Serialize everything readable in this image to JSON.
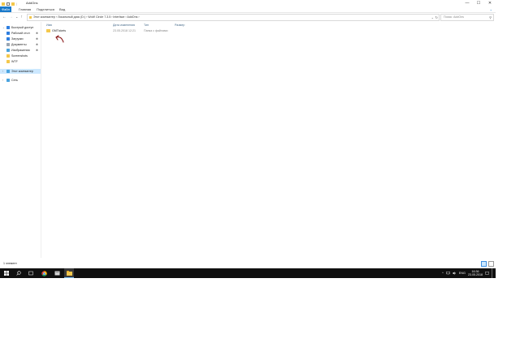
{
  "window": {
    "title": "AddOns",
    "controls": {
      "minimize": "—",
      "maximize": "☐",
      "close": "✕"
    }
  },
  "ribbon": {
    "tabs": [
      "Файл",
      "Главная",
      "Поделиться",
      "Вид"
    ],
    "help_icon": "chevron-down",
    "help_glyph": "⌄"
  },
  "navigation": {
    "back_glyph": "←",
    "forward_glyph": "→",
    "recent_glyph": "⌄",
    "up_glyph": "↑"
  },
  "address": {
    "breadcrumb": [
      "Этот компьютер",
      "Локальный диск (D:)",
      "WoW Circle 7.3.5",
      "Interface",
      "AddOns"
    ],
    "separator": "›",
    "dropdown_glyph": "⌄",
    "refresh_glyph": "↻"
  },
  "search": {
    "placeholder": "Поиск: AddOns",
    "icon_glyph": "⚲"
  },
  "sidebar": {
    "items": [
      {
        "label": "Быстрый доступ",
        "icon": "star-icon",
        "color": "#2f7fe0",
        "pin": false
      },
      {
        "label": "Рабочий стол",
        "icon": "desktop-icon",
        "color": "#2f7fe0",
        "pin": true
      },
      {
        "label": "Загрузки",
        "icon": "download-icon",
        "color": "#2f7fe0",
        "pin": true
      },
      {
        "label": "Документы",
        "icon": "documents-icon",
        "color": "#9aa7b4",
        "pin": true
      },
      {
        "label": "Изображения",
        "icon": "pictures-icon",
        "color": "#4aa3df",
        "pin": true
      },
      {
        "label": "Screenshots",
        "icon": "folder-icon",
        "color": "#f4c84c",
        "pin": false
      },
      {
        "label": "WTF",
        "icon": "folder-icon",
        "color": "#f4c84c",
        "pin": false
      },
      {
        "label": "Этот компьютер",
        "icon": "computer-icon",
        "color": "#4aa3df",
        "pin": false
      },
      {
        "label": "Сеть",
        "icon": "network-icon",
        "color": "#4aa3df",
        "pin": false
      }
    ],
    "pin_glyph": "✱",
    "expand_glyph": "›"
  },
  "columns": [
    "Имя",
    "Дата изменения",
    "Тип",
    "Размер"
  ],
  "files": [
    {
      "name": "GMTickets",
      "date": "23.05.2018 12:21",
      "type": "Папка с файлами",
      "size": ""
    }
  ],
  "status": {
    "count": "1 элемент"
  },
  "taskbar": {
    "apps": [
      "start",
      "search",
      "task-view",
      "chrome",
      "explorer-pinned",
      "file-explorer"
    ],
    "tray": {
      "up_glyph": "^",
      "lang": "ENG",
      "time": "16:36",
      "date": "23.05.2018"
    }
  },
  "colors": {
    "accent": "#1979ca",
    "selection": "#cce8ff",
    "taskbar": "#101010",
    "folder": "#f4c84c",
    "arrow": "#8b1a1a"
  }
}
